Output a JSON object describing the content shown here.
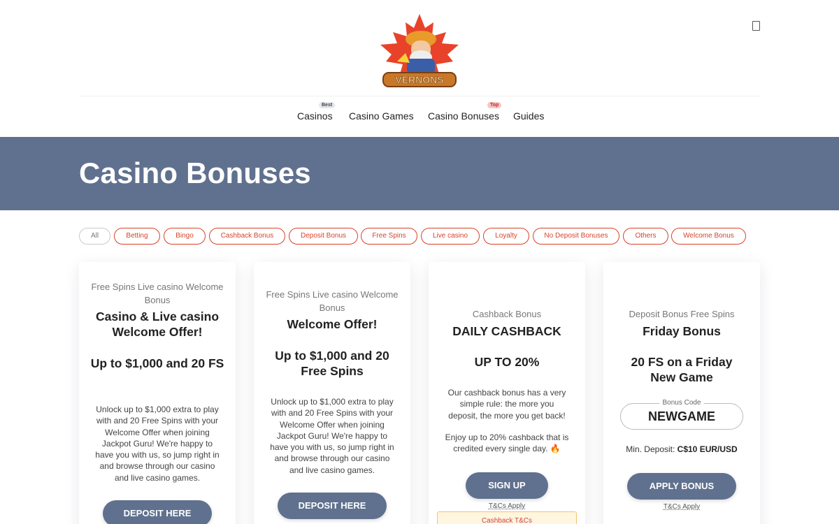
{
  "brand": {
    "logo_text": "VERNONS"
  },
  "nav": [
    {
      "label": "Casinos",
      "badge": "Best"
    },
    {
      "label": "Casino Games",
      "badge": ""
    },
    {
      "label": "Casino Bonuses",
      "badge": "Top"
    },
    {
      "label": "Guides",
      "badge": ""
    }
  ],
  "banner": {
    "title": "Casino Bonuses"
  },
  "filters": [
    "All",
    "Betting",
    "Bingo",
    "Cashback Bonus",
    "Deposit Bonus",
    "Free Spins",
    "Live casino",
    "Loyalty",
    "No Deposit Bonuses",
    "Others",
    "Welcome Bonus"
  ],
  "cards": [
    {
      "category": "Free Spins Live casino Welcome Bonus",
      "title": "Casino & Live casino Welcome Offer!",
      "amount": "Up to $1,000 and 20 FS",
      "description": "Unlock up to $1,000 extra to play with and 20 Free Spins with your Welcome Offer when joining Jackpot Guru! We're happy to have you with us, so jump right in and browse through our casino and live casino games.",
      "button": "Deposit Here"
    },
    {
      "category": "Free Spins Live casino Welcome Bonus",
      "title": "Welcome Offer!",
      "amount": "Up to $1,000 and 20 Free Spins",
      "description": "Unlock up to $1,000 extra to play with and 20 Free Spins with your Welcome Offer when joining Jackpot Guru! We're happy to have you with us, so jump right in and browse through our casino and live casino games.",
      "button": "Deposit Here"
    },
    {
      "category": "Cashback Bonus",
      "title": "DAILY CASHBACK",
      "amount": "UP TO 20%",
      "description": "Our cashback bonus has a very simple rule: the more you deposit, the more you get back!",
      "description2": "Enjoy up to 20% cashback that is credited every single day. 🔥",
      "button": "Sign Up",
      "tcs": "T&Cs Apply",
      "terms_box": "Cashback T&Cs"
    },
    {
      "category": "Deposit Bonus Free Spins",
      "title": "Friday Bonus",
      "amount": "20 FS on a Friday New Game",
      "code_label": "Bonus Code",
      "code": "NEWGAME",
      "min_deposit_label": "Min. Deposit:",
      "min_deposit_value": "C$10 EUR/USD",
      "button": "Apply Bonus",
      "tcs": "T&Cs Apply"
    }
  ],
  "colors": {
    "banner": "#60718f",
    "accent": "#d8432a",
    "button": "#60718f"
  },
  "icons": {
    "corner": "tablet-icon"
  }
}
